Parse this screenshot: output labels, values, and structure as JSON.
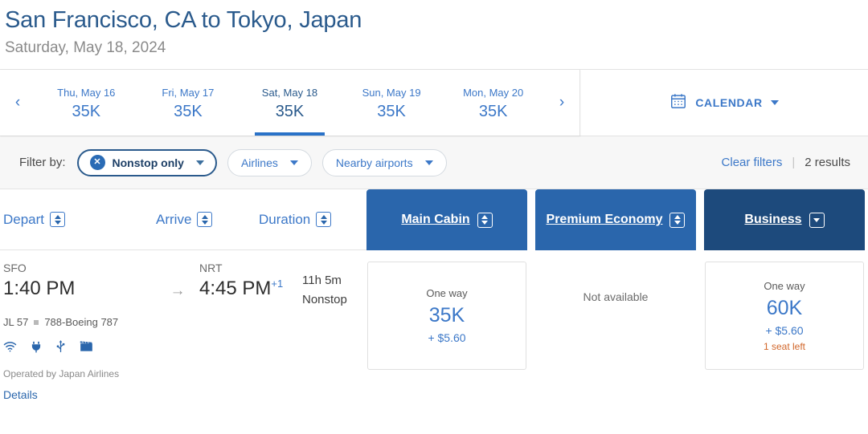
{
  "header": {
    "route_title": "San Francisco, CA to Tokyo, Japan",
    "route_date": "Saturday, May 18, 2024"
  },
  "datebar": {
    "prev_icon": "‹",
    "next_icon": "›",
    "dates": [
      {
        "label": "Thu, May 16",
        "price": "35K",
        "selected": false
      },
      {
        "label": "Fri, May 17",
        "price": "35K",
        "selected": false
      },
      {
        "label": "Sat, May 18",
        "price": "35K",
        "selected": true
      },
      {
        "label": "Sun, May 19",
        "price": "35K",
        "selected": false
      },
      {
        "label": "Mon, May 20",
        "price": "35K",
        "selected": false
      }
    ],
    "calendar_label": "CALENDAR"
  },
  "filters": {
    "label": "Filter by:",
    "pills": [
      {
        "label": "Nonstop only",
        "active": true,
        "close_icon": "✕"
      },
      {
        "label": "Airlines",
        "active": false
      },
      {
        "label": "Nearby airports",
        "active": false
      }
    ],
    "clear_filters": "Clear filters",
    "divider": "|",
    "results_count": "2 results"
  },
  "columns": {
    "depart": "Depart",
    "arrive": "Arrive",
    "duration": "Duration"
  },
  "cabins": [
    {
      "name": "Main Cabin",
      "color": "#2a66ac",
      "sort": "both"
    },
    {
      "name": "Premium Economy",
      "color": "#2a66ac",
      "sort": "both"
    },
    {
      "name": "Business",
      "color": "#1d4a7c",
      "sort": "down"
    }
  ],
  "flight": {
    "depart_airport": "SFO",
    "depart_time": "1:40 PM",
    "arrow": "→",
    "arrive_airport": "NRT",
    "arrive_time": "4:45 PM",
    "arrive_day_offset": "+1",
    "duration": "11h 5m",
    "stops": "Nonstop",
    "flight_number": "JL 57",
    "aircraft": "788-Boeing 787",
    "amenities": [
      "wifi-icon",
      "power-outlet-icon",
      "usb-port-icon",
      "entertainment-icon"
    ],
    "operated_by": "Operated by Japan Airlines",
    "details_link": "Details"
  },
  "fares": [
    {
      "cabin": "Main Cabin",
      "available": true,
      "type_label": "One way",
      "miles": "35K",
      "tax": "+ $5.60",
      "seats_left": ""
    },
    {
      "cabin": "Premium Economy",
      "available": false,
      "unavailable_label": "Not available"
    },
    {
      "cabin": "Business",
      "available": true,
      "type_label": "One way",
      "miles": "60K",
      "tax": "+ $5.60",
      "seats_left": "1 seat left"
    }
  ]
}
